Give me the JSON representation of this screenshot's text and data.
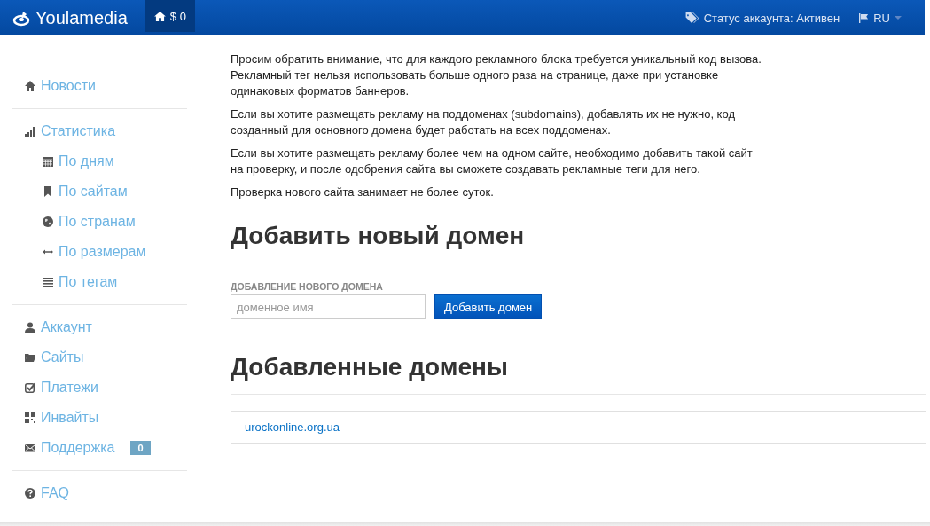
{
  "navbar": {
    "brand": "Youlamedia",
    "balance": "$ 0",
    "status": "Статус аккаунта: Активен",
    "language": "RU"
  },
  "sidebar": {
    "groups": [
      {
        "items": [
          {
            "label": "Новости"
          }
        ]
      },
      {
        "items": [
          {
            "label": "Статистика",
            "children": [
              {
                "label": "По дням"
              },
              {
                "label": "По сайтам"
              },
              {
                "label": "По странам"
              },
              {
                "label": "По размерам"
              },
              {
                "label": "По тегам"
              }
            ]
          }
        ]
      },
      {
        "items": [
          {
            "label": "Аккаунт"
          },
          {
            "label": "Сайты"
          },
          {
            "label": "Платежи"
          },
          {
            "label": "Инвайты"
          },
          {
            "label": "Поддержка",
            "badge": "0"
          }
        ]
      },
      {
        "items": [
          {
            "label": "FAQ"
          }
        ]
      }
    ]
  },
  "notes": [
    "Просим обратить внимание, что для каждого рекламного блока требуется уникальный код вызова. Рекламный тег нельзя использовать больше одного раза на странице, даже при установке одинаковых форматов баннеров.",
    "Если вы хотите размещать рекламу на поддоменах (subdomains), добавлять их не нужно, код созданный для основного домена будет работать на всех поддоменах.",
    "Если вы хотите размещать рекламу более чем на одном сайте, необходимо добавить такой сайт на проверку, и после одобрения сайта вы сможете создавать рекламные теги для него.",
    "Проверка нового сайта занимает не более суток."
  ],
  "add_domain": {
    "heading": "Добавить новый домен",
    "field_label": "ДОБАВЛЕНИЕ НОВОГО ДОМЕНА",
    "placeholder": "доменное имя",
    "button": "Добавить домен"
  },
  "domains": {
    "heading": "Добавленные домены",
    "items": [
      "urockonline.org.ua"
    ]
  }
}
